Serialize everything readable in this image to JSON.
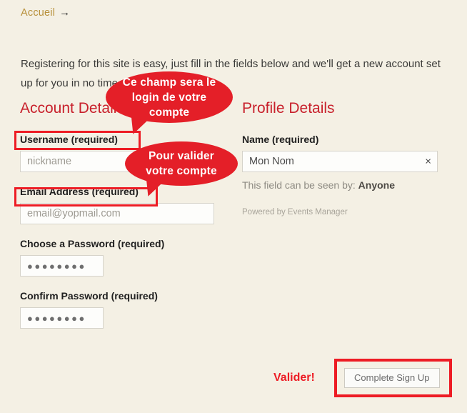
{
  "page": {
    "background_color": "#f4f0e4",
    "accent_red": "#ed1c24",
    "heading_red": "#c8212c",
    "link_gold": "#b8913c"
  },
  "breadcrumb": {
    "link_label": "Accueil",
    "arrow": "→"
  },
  "intro": {
    "text": "Registering for this site is easy, just fill in the fields below and we'll get a new account set up for you in no time."
  },
  "account_details": {
    "title": "Account Details",
    "username": {
      "label": "Username (required)",
      "placeholder": "nickname",
      "value": ""
    },
    "email": {
      "label": "Email Address (required)",
      "placeholder": "email@yopmail.com",
      "value": ""
    },
    "password": {
      "label": "Choose a Password (required)",
      "masked_value": "●●●●●●●●"
    },
    "password_confirm": {
      "label": "Confirm Password (required)",
      "masked_value": "●●●●●●●●"
    }
  },
  "profile_details": {
    "title": "Profile Details",
    "name": {
      "label": "Name (required)",
      "value": "Mon Nom",
      "clear_icon": "×"
    },
    "visibility_prefix": "This field can be seen by: ",
    "visibility_value": "Anyone",
    "powered_by": "Powered by Events Manager"
  },
  "submit": {
    "annotation": "Valider!",
    "button_label": "Complete Sign Up"
  },
  "annotations": {
    "bubble_1": "Ce champ sera le login de votre compte",
    "bubble_2": "Pour valider votre compte",
    "highlight_color": "#ed1c24"
  }
}
